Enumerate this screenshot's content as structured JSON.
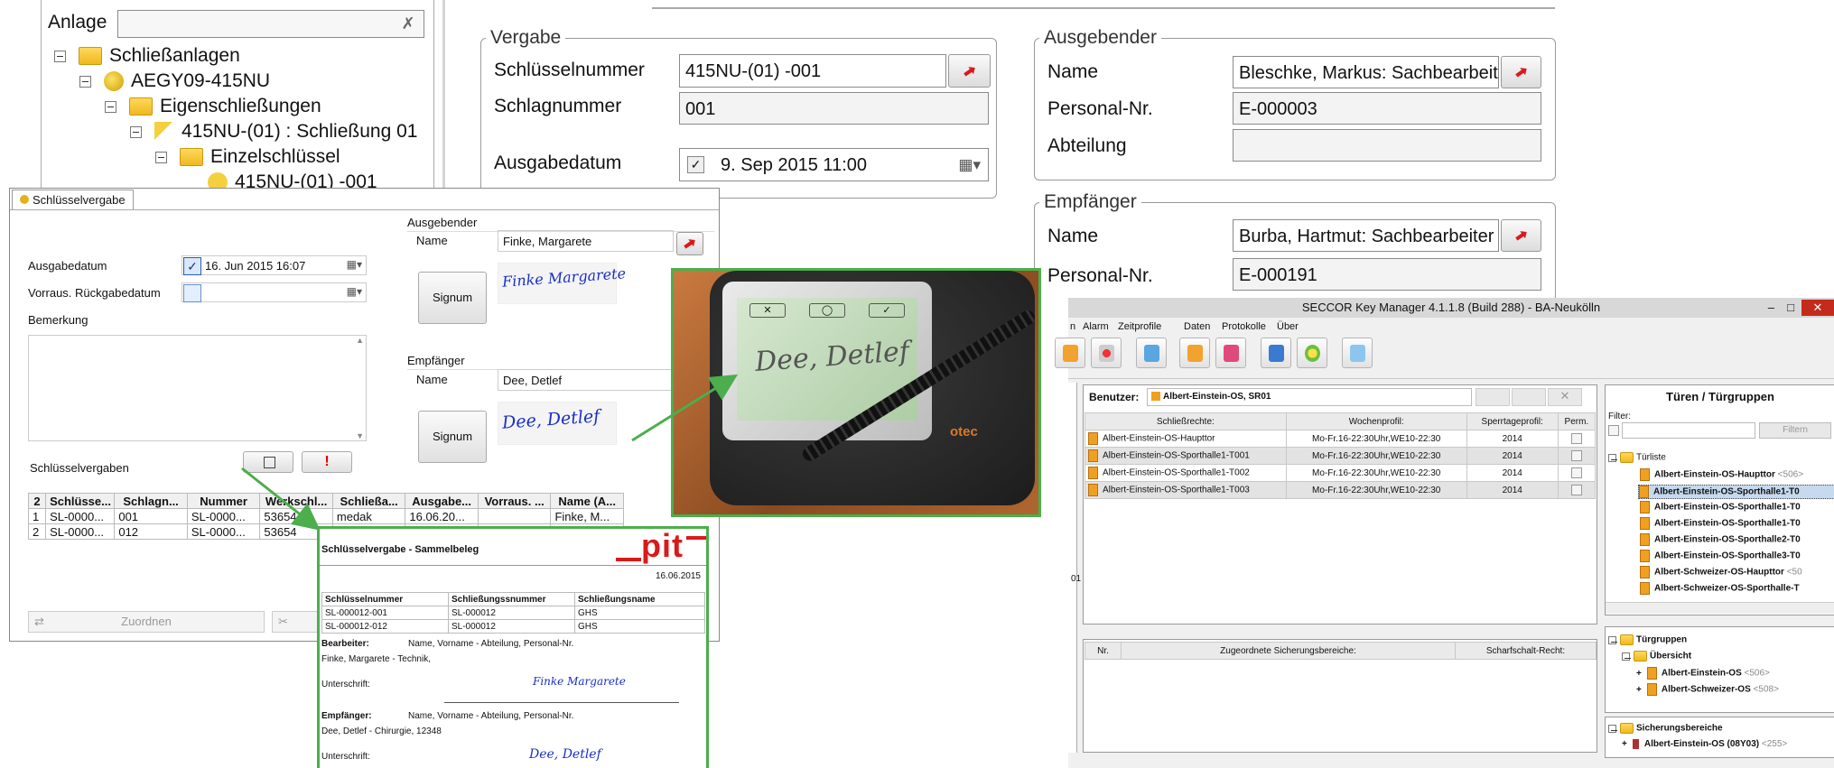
{
  "tree": {
    "anlage_label": "Anlage",
    "nodes": [
      {
        "label": "Schließanlagen"
      },
      {
        "label": "AEGY09-415NU"
      },
      {
        "label": "Eigenschließungen"
      },
      {
        "label": "415NU-(01) : Schließung 01"
      },
      {
        "label": "Einzelschlüssel"
      },
      {
        "label": "415NU-(01) -001"
      }
    ]
  },
  "vergabe": {
    "legend": "Vergabe",
    "schluesselnummer_label": "Schlüsselnummer",
    "schluesselnummer_value": "415NU-(01) -001",
    "schlagnummer_label": "Schlagnummer",
    "schlagnummer_value": "001",
    "ausgabedatum_label": "Ausgabedatum",
    "ausgabedatum_value": "9. Sep 2015 11:00"
  },
  "ausgebender_big": {
    "legend": "Ausgebender",
    "name_label": "Name",
    "name_value": "Bleschke, Markus: Sachbearbeiter",
    "personal_label": "Personal-Nr.",
    "personal_value": "E-000003",
    "abteilung_label": "Abteilung",
    "abteilung_value": ""
  },
  "empfaenger_big": {
    "legend": "Empfänger",
    "name_label": "Name",
    "name_value": "Burba, Hartmut: Sachbearbeiter",
    "personal_label": "Personal-Nr.",
    "personal_value": "E-000191"
  },
  "dialog": {
    "tab_title": "Schlüsselvergabe",
    "ausgabedatum_label": "Ausgabedatum",
    "ausgabedatum_value": "16. Jun 2015 16:07",
    "rueckgabe_label": "Vorraus. Rückgabedatum",
    "bemerkung_label": "Bemerkung",
    "ausgebender_label": "Ausgebender",
    "ausgebender_name_label": "Name",
    "ausgebender_name_value": "Finke, Margarete",
    "ausgebender_signature": "Finke Margarete",
    "empfaenger_label": "Empfänger",
    "empfaenger_name_label": "Name",
    "empfaenger_name_value": "Dee, Detlef",
    "empfaenger_signature": "Dee, Detlef",
    "signum_label": "Signum",
    "vergaben_label": "Schlüsselvergaben",
    "warn_symbol": "!",
    "zuordnen_label": "Zuordnen",
    "table": {
      "count": "2",
      "headers": [
        "Schlüsse...",
        "Schlagn...",
        "Nummer",
        "Werkschl...",
        "Schließa...",
        "Ausgabe...",
        "Vorraus. ...",
        "Name (A..."
      ],
      "rows": [
        [
          "1",
          "SL-0000...",
          "001",
          "SL-0000...",
          "53654",
          "medak",
          "16.06.20...",
          "",
          "Finke, M..."
        ],
        [
          "2",
          "SL-0000...",
          "012",
          "SL-0000...",
          "53654",
          "",
          "",
          "",
          ""
        ]
      ]
    }
  },
  "receipt": {
    "title": "Schlüsselvergabe - Sammelbeleg",
    "logo": "pit",
    "date": "16.06.2015",
    "headers": [
      "Schlüsselnummer",
      "Schließungssnummer",
      "Schließungsname"
    ],
    "rows": [
      [
        "SL-000012-001",
        "SL-000012",
        "GHS"
      ],
      [
        "SL-000012-012",
        "SL-000012",
        "GHS"
      ]
    ],
    "bearbeiter_label": "Bearbeiter:",
    "bearbeiter_caption": "Name, Vorname - Abteilung, Personal-Nr.",
    "bearbeiter_value": "Finke, Margarete - Technik,",
    "unterschrift_label": "Unterschrift:",
    "empfaenger_label": "Empfänger:",
    "empfaenger_caption": "Name, Vorname - Abteilung, Personal-Nr.",
    "empfaenger_value": "Dee, Detlef - Chirurgie, 12348"
  },
  "keymanager": {
    "title": "SECCOR Key Manager 4.1.1.8 (Build 288) - BA-Neukölln",
    "menu": [
      "n",
      "Alarm",
      "Zeitprofile",
      "Daten",
      "Protokolle",
      "Über"
    ],
    "benutzer_label": "Benutzer:",
    "benutzer_value": "Albert-Einstein-OS, SR01",
    "side_fragment": "01",
    "table_headers": [
      "Schließrechte:",
      "Wochenprofil:",
      "Sperrtageprofil:",
      "Perm."
    ],
    "table_rows": [
      [
        "Albert-Einstein-OS-Haupttor",
        "Mo-Fr.16-22:30Uhr,WE10-22:30",
        "2014"
      ],
      [
        "Albert-Einstein-OS-Sporthalle1-T001",
        "Mo-Fr.16-22:30Uhr,WE10-22:30",
        "2014"
      ],
      [
        "Albert-Einstein-OS-Sporthalle1-T002",
        "Mo-Fr.16-22:30Uhr,WE10-22:30",
        "2014"
      ],
      [
        "Albert-Einstein-OS-Sporthalle1-T003",
        "Mo-Fr.16-22:30Uhr,WE10-22:30",
        "2014"
      ]
    ],
    "lower_headers": [
      "Nr.",
      "Zugeordnete Sicherungsbereiche:",
      "Scharfschalt-Recht:"
    ],
    "right_title": "Türen / Türgruppen",
    "filter_label": "Filter:",
    "filter_button": "Filtern",
    "tuerliste_label": "Türliste",
    "tuerliste": [
      {
        "label": "Albert-Einstein-OS-Haupttor",
        "suffix": "<506>"
      },
      {
        "label": "Albert-Einstein-OS-Sporthalle1-T0",
        "suffix": ""
      },
      {
        "label": "Albert-Einstein-OS-Sporthalle1-T0",
        "suffix": ""
      },
      {
        "label": "Albert-Einstein-OS-Sporthalle1-T0",
        "suffix": ""
      },
      {
        "label": "Albert-Einstein-OS-Sporthalle2-T0",
        "suffix": ""
      },
      {
        "label": "Albert-Einstein-OS-Sporthalle3-T0",
        "suffix": ""
      },
      {
        "label": "Albert-Schweizer-OS-Haupttor",
        "suffix": "<50"
      },
      {
        "label": "Albert-Schweizer-OS-Sporthalle-T",
        "suffix": ""
      }
    ],
    "tuergruppen_label": "Türgruppen",
    "uebersicht_label": "Übersicht",
    "gruppen": [
      {
        "label": "Albert-Einstein-OS",
        "suffix": "<506>"
      },
      {
        "label": "Albert-Schweizer-OS",
        "suffix": "<508>"
      }
    ],
    "sicherung_label": "Sicherungsbereiche",
    "sicherung_item": {
      "label": "Albert-Einstein-OS (08Y03)",
      "suffix": "<255>"
    }
  },
  "pad_brand": "otec",
  "colors": {
    "green": "#4cae4c",
    "red": "#d91a1a",
    "select": "#c6d9ee"
  }
}
